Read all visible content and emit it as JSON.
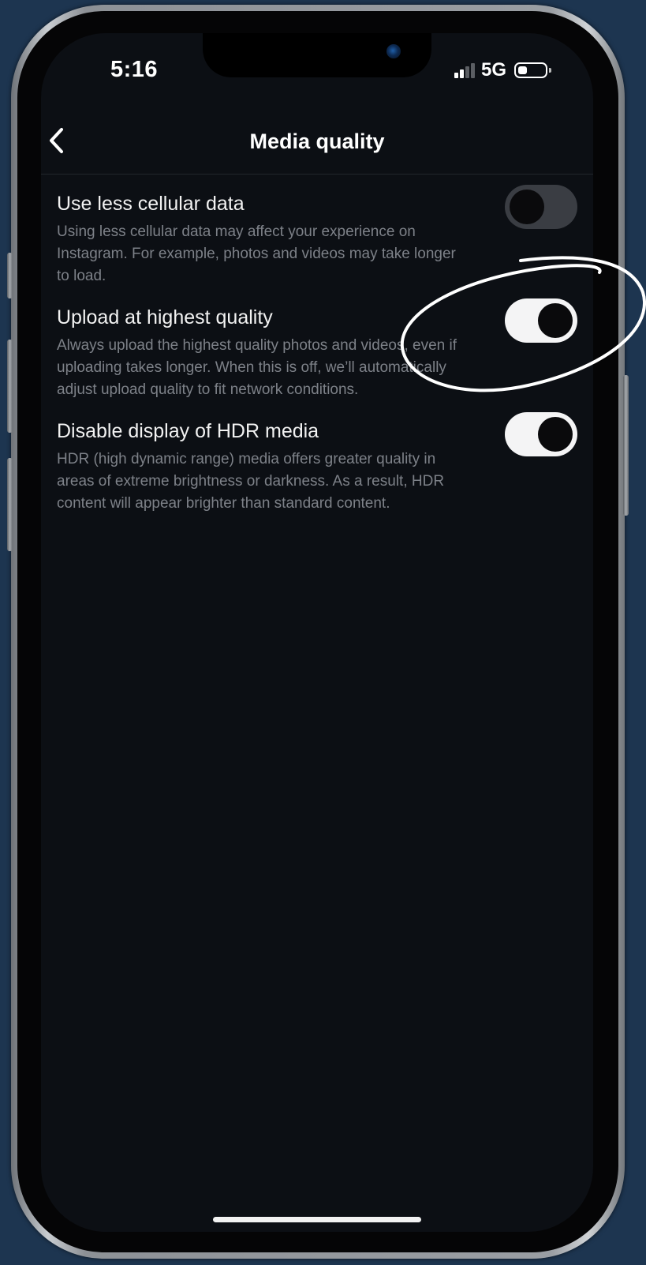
{
  "status_bar": {
    "time": "5:16",
    "network": "5G",
    "signal_bars_active": 2,
    "signal_bars_total": 4,
    "battery_level": 0.35
  },
  "nav": {
    "title": "Media quality",
    "back_icon": "chevron-left-icon"
  },
  "settings": [
    {
      "title": "Use less cellular data",
      "description": "Using less cellular data may affect your experience on Instagram. For example, photos and videos may take longer to load.",
      "enabled": false
    },
    {
      "title": "Upload at highest quality",
      "description": "Always upload the highest quality photos and videos, even if uploading takes longer. When this is off, we’ll automatically adjust upload quality to fit network conditions.",
      "enabled": true,
      "highlighted": true
    },
    {
      "title": "Disable display of HDR media",
      "description": "HDR (high dynamic range) media offers greater quality in areas of extreme brightness or darkness. As a result, HDR content will appear brighter than standard content.",
      "enabled": true
    }
  ],
  "colors": {
    "background": "#1d3550",
    "screen": "#0c0f14",
    "toggle_on": "#f4f4f5",
    "toggle_off": "#3a3d43",
    "description_text": "#7d8188",
    "annotation": "#ffffff"
  }
}
